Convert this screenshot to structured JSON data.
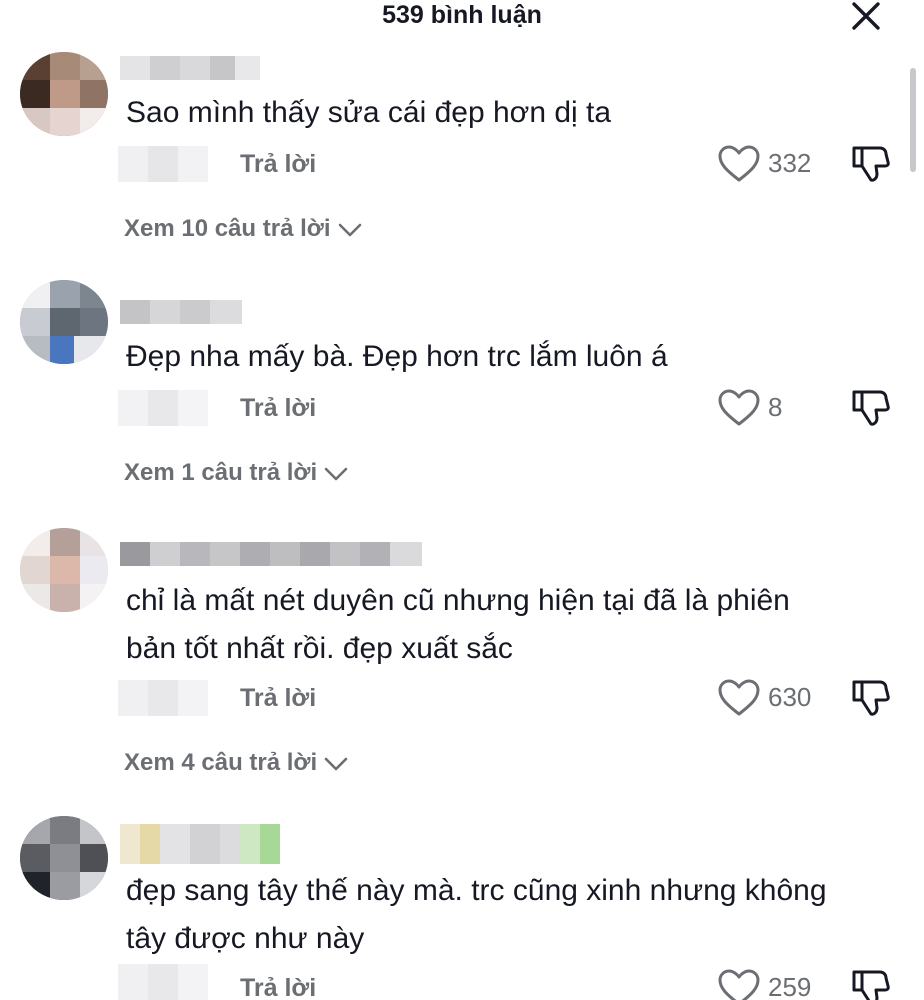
{
  "header": {
    "title": "539 bình luận",
    "close_icon": "close-icon"
  },
  "comments": [
    {
      "text": "Sao mình thấy sửa cái đẹp hơn dị ta",
      "reply_label": "Trả lời",
      "likes": "332",
      "view_replies": "Xem 10 câu trả lời"
    },
    {
      "text": "Đẹp nha mấy bà. Đẹp hơn trc lắm luôn á",
      "reply_label": "Trả lời",
      "likes": "8",
      "view_replies": "Xem 1 câu trả lời"
    },
    {
      "text": "chỉ là mất nét duyên cũ nhưng hiện tại đã là phiên bản tốt nhất rồi. đẹp xuất sắc",
      "reply_label": "Trả lời",
      "likes": "630",
      "view_replies": "Xem 4 câu trả lời"
    },
    {
      "text": "đẹp sang tây thế này mà. trc cũng xinh nhưng không tây được như này",
      "reply_label": "Trả lời",
      "likes": "259"
    }
  ],
  "icons": {
    "like": "heart-icon",
    "dislike": "thumbs-down-icon",
    "expand": "chevron-down-icon"
  },
  "colors": {
    "text_primary": "#161823",
    "text_secondary": "#6b6e73",
    "background": "#ffffff"
  }
}
